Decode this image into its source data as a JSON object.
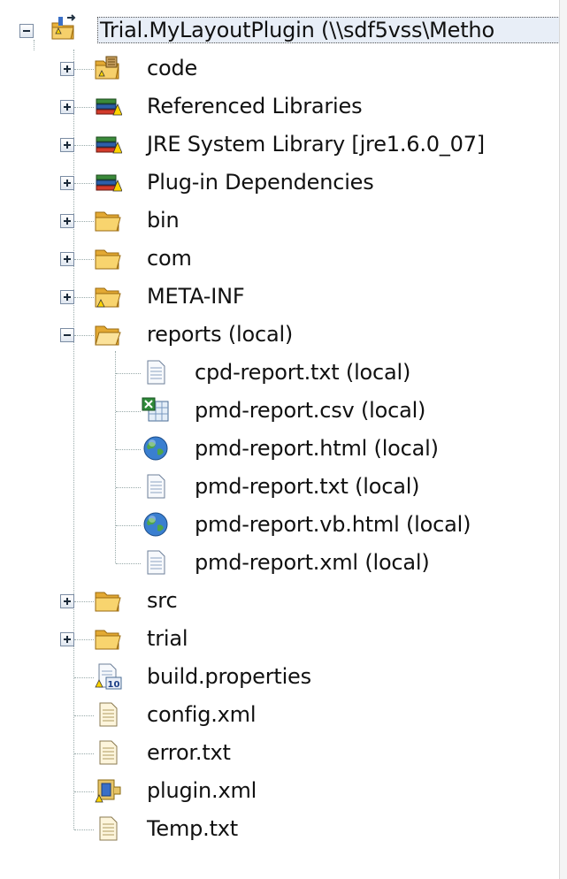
{
  "tree": {
    "root": {
      "label": "Trial.MyLayoutPlugin  (\\\\sdf5vss\\Metho"
    },
    "items": [
      {
        "label": "code"
      },
      {
        "label": "Referenced Libraries"
      },
      {
        "label": "JRE System Library [jre1.6.0_07]"
      },
      {
        "label": "Plug-in Dependencies"
      },
      {
        "label": "bin"
      },
      {
        "label": "com"
      },
      {
        "label": "META-INF"
      },
      {
        "label": "reports  (local)"
      },
      {
        "label": "src"
      },
      {
        "label": "trial"
      },
      {
        "label": "build.properties"
      },
      {
        "label": "config.xml"
      },
      {
        "label": "error.txt"
      },
      {
        "label": "plugin.xml"
      },
      {
        "label": "Temp.txt"
      }
    ],
    "reports_children": [
      {
        "label": "cpd-report.txt  (local)"
      },
      {
        "label": "pmd-report.csv  (local)"
      },
      {
        "label": "pmd-report.html  (local)"
      },
      {
        "label": "pmd-report.txt  (local)"
      },
      {
        "label": "pmd-report.vb.html  (local)"
      },
      {
        "label": "pmd-report.xml  (local)"
      }
    ]
  },
  "icons": {
    "folder": "folder-icon",
    "folder_open": "folder-open-icon",
    "library": "library-icon",
    "text_file": "text-file-icon",
    "web_file": "globe-icon",
    "csv_file": "spreadsheet-file-icon",
    "properties_file": "properties-file-icon",
    "plugin_file": "plugin-manifest-icon",
    "project": "plugin-project-icon"
  },
  "colors": {
    "folder": "#f2c44a",
    "selection": "#e8eef7"
  }
}
